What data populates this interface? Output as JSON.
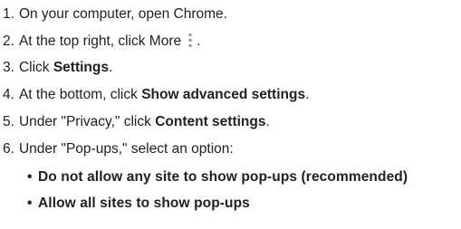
{
  "steps": [
    {
      "num": "1.",
      "pre": "On your computer, open Chrome.",
      "bold": "",
      "post": ""
    },
    {
      "num": "2.",
      "pre": "At the top right, click More",
      "bold": "",
      "post": "."
    },
    {
      "num": "3.",
      "pre": "Click ",
      "bold": "Settings",
      "post": "."
    },
    {
      "num": "4.",
      "pre": "At the bottom, click ",
      "bold": "Show advanced settings",
      "post": "."
    },
    {
      "num": "5.",
      "pre": "Under \"Privacy,\" click ",
      "bold": "Content settings",
      "post": "."
    },
    {
      "num": "6.",
      "pre": "Under \"Pop-ups,\" select an option:",
      "bold": "",
      "post": ""
    }
  ],
  "options": [
    {
      "bullet": "•",
      "label": "Do not allow any site to show pop-ups (recommended)"
    },
    {
      "bullet": "•",
      "label": "Allow all sites to show pop-ups"
    }
  ],
  "icons": {
    "more": "more-vert-icon"
  }
}
